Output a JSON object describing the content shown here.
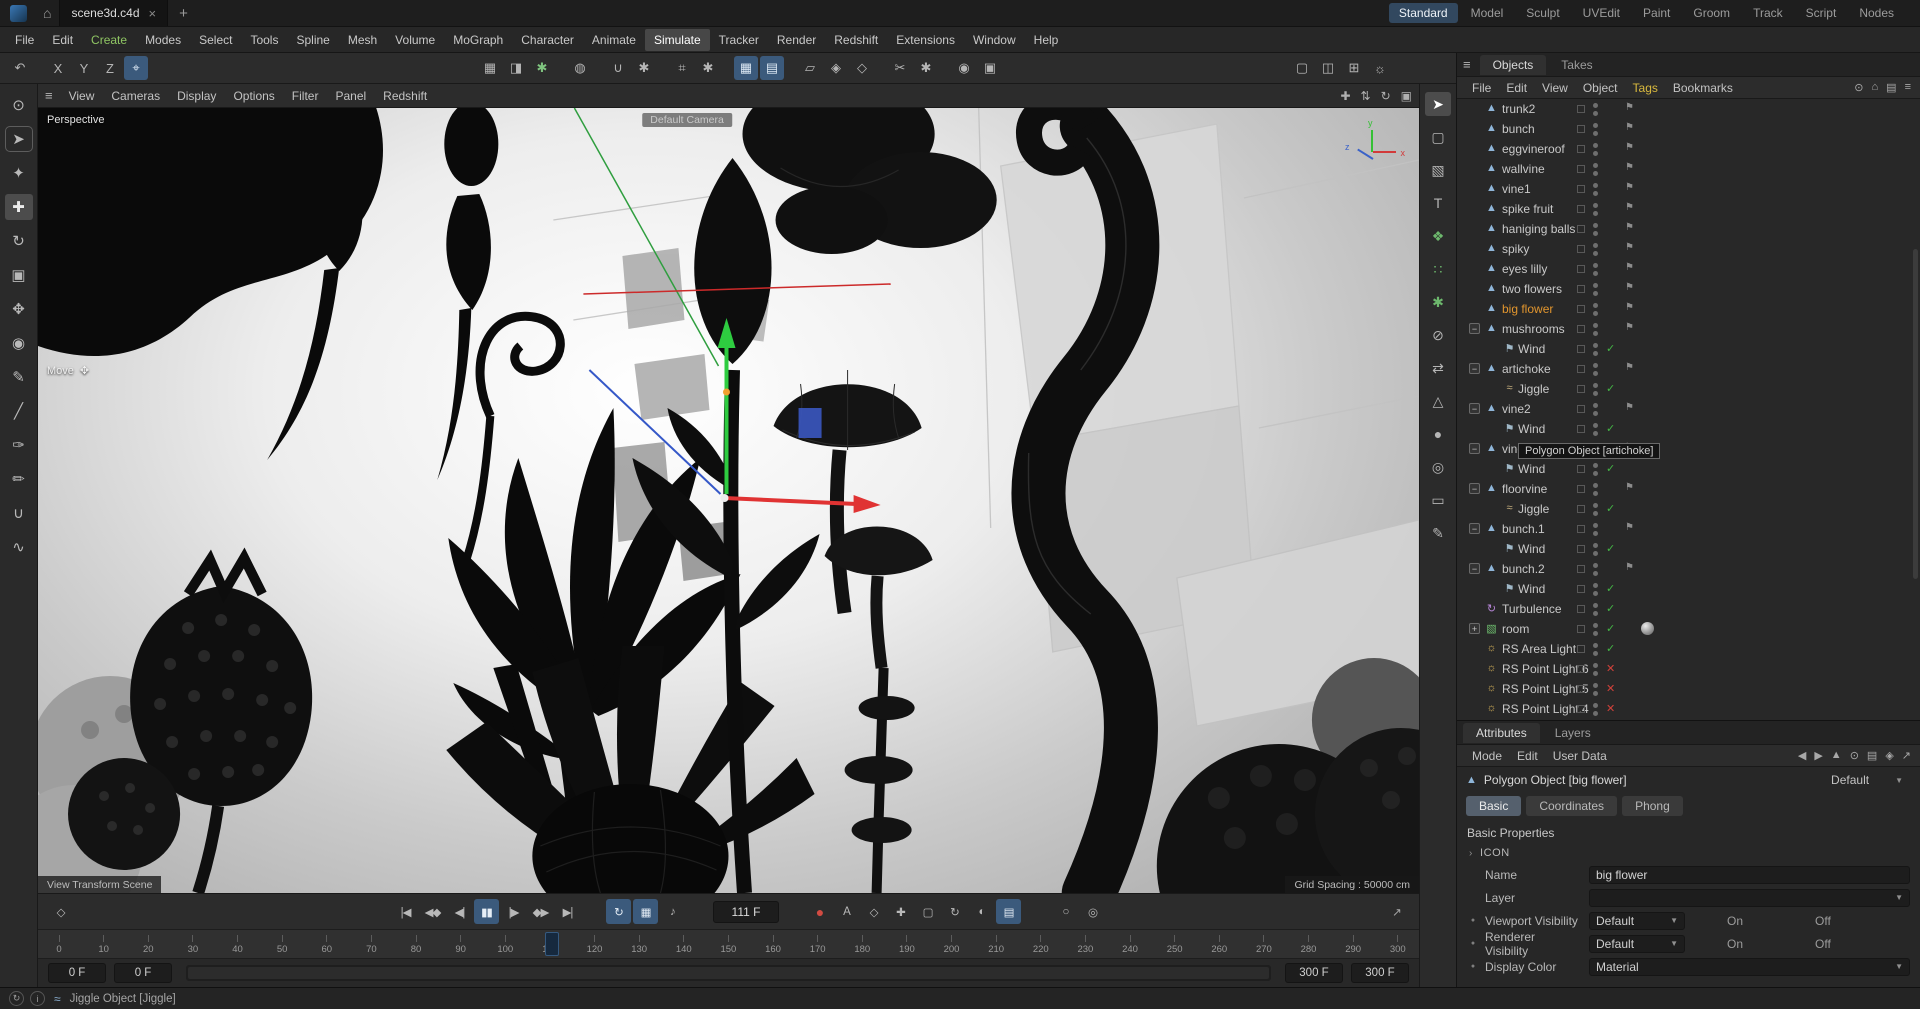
{
  "titlebar": {
    "tab_title": "scene3d.c4d",
    "close_glyph": "×",
    "add_glyph": "+",
    "home_glyph": "⌂",
    "layout_tabs": [
      {
        "name": "layout-standard",
        "label": "Standard",
        "active": true
      },
      {
        "name": "layout-model",
        "label": "Model"
      },
      {
        "name": "layout-sculpt",
        "label": "Sculpt"
      },
      {
        "name": "layout-uvedit",
        "label": "UVEdit"
      },
      {
        "name": "layout-paint",
        "label": "Paint"
      },
      {
        "name": "layout-groom",
        "label": "Groom"
      },
      {
        "name": "layout-track",
        "label": "Track"
      },
      {
        "name": "layout-script",
        "label": "Script"
      },
      {
        "name": "layout-nodes",
        "label": "Nodes"
      }
    ]
  },
  "menubar": {
    "items": [
      {
        "label": "File"
      },
      {
        "label": "Edit"
      },
      {
        "label": "Create",
        "accent": true
      },
      {
        "label": "Modes"
      },
      {
        "label": "Select"
      },
      {
        "label": "Tools"
      },
      {
        "label": "Spline"
      },
      {
        "label": "Mesh"
      },
      {
        "label": "Volume"
      },
      {
        "label": "MoGraph"
      },
      {
        "label": "Character"
      },
      {
        "label": "Animate"
      },
      {
        "label": "Simulate",
        "active": true
      },
      {
        "label": "Tracker"
      },
      {
        "label": "Render"
      },
      {
        "label": "Redshift"
      },
      {
        "label": "Extensions"
      },
      {
        "label": "Window"
      },
      {
        "label": "Help"
      }
    ]
  },
  "toolbar": {
    "g1": [
      {
        "name": "undo-icon",
        "glyph": "↶"
      }
    ],
    "g2": [
      {
        "name": "axis-x-toggle",
        "glyph": "X"
      },
      {
        "name": "axis-y-toggle",
        "glyph": "Y"
      },
      {
        "name": "axis-z-toggle",
        "glyph": "Z"
      },
      {
        "name": "coord-system-toggle",
        "glyph": "⌖",
        "active": true
      }
    ],
    "g3": [
      {
        "name": "render-view-button",
        "glyph": "▦"
      },
      {
        "name": "render-region-button",
        "glyph": "◨"
      },
      {
        "name": "render-settings-button",
        "glyph": "✱",
        "green": true
      }
    ],
    "g4": [
      {
        "name": "generators-button",
        "glyph": "◍"
      }
    ],
    "g5": [
      {
        "name": "snap-magnet-button",
        "glyph": "∪"
      },
      {
        "name": "snap-settings-button",
        "glyph": "✱"
      }
    ],
    "g6": [
      {
        "name": "anchor-button",
        "glyph": "⌗"
      },
      {
        "name": "anchor-settings-button",
        "glyph": "✱"
      }
    ],
    "g7": [
      {
        "name": "grid-snap-button",
        "glyph": "▦",
        "active": true
      },
      {
        "name": "quantize-button",
        "glyph": "▤",
        "active": true
      }
    ],
    "g8": [
      {
        "name": "workplane-button",
        "glyph": "▱"
      },
      {
        "name": "workplane-mode-button",
        "glyph": "◈"
      },
      {
        "name": "workplane-lock-button",
        "glyph": "◇"
      }
    ],
    "g9": [
      {
        "name": "cut-button",
        "glyph": "✂"
      },
      {
        "name": "cut-settings-button",
        "glyph": "✱"
      }
    ],
    "g10": [
      {
        "name": "axis-lock-button",
        "glyph": "◉"
      },
      {
        "name": "lock-button",
        "glyph": "▣"
      }
    ],
    "right": [
      {
        "name": "layout-single-view-button",
        "glyph": "▢"
      },
      {
        "name": "layout-split-view-button",
        "glyph": "◫"
      },
      {
        "name": "layout-quad-view-button",
        "glyph": "⊞"
      },
      {
        "name": "default-lights-button",
        "glyph": "☼"
      }
    ]
  },
  "left_toolbar": [
    {
      "name": "viewport-filter-icon",
      "glyph": "⊙"
    },
    {
      "name": "live-selection-icon",
      "glyph": "➤",
      "ring": true
    },
    {
      "name": "tweak-mode-icon",
      "glyph": "✦"
    },
    {
      "name": "move-tool-icon",
      "glyph": "✚",
      "active": true
    },
    {
      "name": "rotate-tool-icon",
      "glyph": "↻"
    },
    {
      "name": "scale-tool-icon",
      "glyph": "▣"
    },
    {
      "name": "axis-mode-icon",
      "glyph": "✥"
    },
    {
      "name": "soft-selection-icon",
      "glyph": "◉"
    },
    {
      "name": "pen-tool-icon",
      "glyph": "✎"
    },
    {
      "name": "knife-tool-icon",
      "glyph": "╱"
    },
    {
      "name": "brush-tool-icon",
      "glyph": "✑"
    },
    {
      "name": "pencil-tool-icon",
      "glyph": "✏"
    },
    {
      "name": "magnet-tool-icon",
      "glyph": "∪"
    },
    {
      "name": "spline-smooth-icon",
      "glyph": "∿"
    }
  ],
  "right_strip": [
    {
      "name": "select-arrow-icon",
      "glyph": "➤",
      "active": true
    },
    {
      "name": "marquee-icon",
      "glyph": "▢"
    },
    {
      "name": "cube-primitive-icon",
      "glyph": "▧"
    },
    {
      "name": "text-object-icon",
      "glyph": "T"
    },
    {
      "name": "cloner-icon",
      "glyph": "❖",
      "green": true
    },
    {
      "name": "matrix-icon",
      "glyph": "∷",
      "green": true
    },
    {
      "name": "dynamics-icon",
      "glyph": "✱",
      "green": true
    },
    {
      "name": "collision-icon",
      "glyph": "⊘"
    },
    {
      "name": "swap-icon",
      "glyph": "⇄"
    },
    {
      "name": "reduce-icon",
      "glyph": "△"
    },
    {
      "name": "sphere-primitive-icon",
      "glyph": "●"
    },
    {
      "name": "camera-object-icon",
      "glyph": "◎"
    },
    {
      "name": "plane-primitive-icon",
      "glyph": "▭"
    },
    {
      "name": "spline-pen-icon",
      "glyph": "✎"
    }
  ],
  "viewport": {
    "menu_icon": "≡",
    "menu": [
      {
        "label": "View"
      },
      {
        "label": "Cameras"
      },
      {
        "label": "Display"
      },
      {
        "label": "Options"
      },
      {
        "label": "Filter"
      },
      {
        "label": "Panel"
      },
      {
        "label": "Redshift"
      }
    ],
    "corner_icons": [
      {
        "name": "pan-view-icon",
        "glyph": "✚"
      },
      {
        "name": "dolly-view-icon",
        "glyph": "⇅"
      },
      {
        "name": "rotate-view-icon",
        "glyph": "↻"
      },
      {
        "name": "maximize-view-icon",
        "glyph": "▣"
      }
    ],
    "label": "Perspective",
    "camera_label": "Default Camera",
    "tool_label": "Move",
    "tool_glyph": "✥",
    "footer_left": "View Transform Scene",
    "footer_right": "Grid Spacing : 50000 cm",
    "axis_x": "x",
    "axis_y": "y",
    "axis_z": "z"
  },
  "object_manager": {
    "panel_tabs": [
      {
        "label": "Objects",
        "active": true
      },
      {
        "label": "Takes"
      }
    ],
    "menu": [
      {
        "label": "File"
      },
      {
        "label": "Edit"
      },
      {
        "label": "View"
      },
      {
        "label": "Object"
      },
      {
        "label": "Tags",
        "accent": true
      },
      {
        "label": "Bookmarks"
      }
    ],
    "icons": [
      {
        "name": "search-icon",
        "glyph": "⊙"
      },
      {
        "name": "home-icon",
        "glyph": "⌂"
      },
      {
        "name": "layer-filter-icon",
        "glyph": "▤"
      },
      {
        "name": "panel-menu-icon",
        "glyph": "≡"
      }
    ],
    "objects": [
      {
        "name": "trunk2",
        "icon": "▲",
        "icls": "ic-poly",
        "flag": true
      },
      {
        "name": "bunch",
        "icon": "▲",
        "icls": "ic-poly",
        "flag": true
      },
      {
        "name": "eggvineroof",
        "icon": "▲",
        "icls": "ic-poly",
        "flag": true
      },
      {
        "name": "wallvine",
        "icon": "▲",
        "icls": "ic-poly",
        "flag": true
      },
      {
        "name": "vine1",
        "icon": "▲",
        "icls": "ic-poly",
        "flag": true
      },
      {
        "name": "spike fruit",
        "icon": "▲",
        "icls": "ic-poly",
        "flag": true
      },
      {
        "name": "haniging balls",
        "icon": "▲",
        "icls": "ic-poly",
        "flag": true
      },
      {
        "name": "spiky",
        "icon": "▲",
        "icls": "ic-poly",
        "flag": true
      },
      {
        "name": "eyes lilly",
        "icon": "▲",
        "icls": "ic-poly",
        "flag": true
      },
      {
        "name": "two flowers",
        "icon": "▲",
        "icls": "ic-poly",
        "flag": true
      },
      {
        "name": "big flower",
        "icon": "▲",
        "icls": "ic-poly",
        "flag": true,
        "sel": true
      },
      {
        "name": "mushrooms",
        "icon": "▲",
        "icls": "ic-poly",
        "exp": "−",
        "flag": true
      },
      {
        "name": "Wind",
        "icon": "⚑",
        "icls": "ic-wind",
        "ind": true,
        "check": true
      },
      {
        "name": "artichoke",
        "icon": "▲",
        "icls": "ic-poly",
        "exp": "−",
        "flag": true
      },
      {
        "name": "Jiggle",
        "icon": "≈",
        "icls": "ic-jiggle",
        "ind": true,
        "check": true
      },
      {
        "name": "vine2",
        "icon": "▲",
        "icls": "ic-poly",
        "exp": "−",
        "flag": true
      },
      {
        "name": "Wind",
        "icon": "⚑",
        "icls": "ic-wind",
        "ind": true,
        "check": true
      },
      {
        "name": "vine2",
        "icon": "▲",
        "icls": "ic-poly",
        "exp": "−",
        "flag": true
      },
      {
        "name": "Wind",
        "icon": "⚑",
        "icls": "ic-wind",
        "ind": true,
        "check": true
      },
      {
        "name": "floorvine",
        "icon": "▲",
        "icls": "ic-poly",
        "exp": "−",
        "flag": true
      },
      {
        "name": "Jiggle",
        "icon": "≈",
        "icls": "ic-jiggle",
        "ind": true,
        "check": true
      },
      {
        "name": "bunch.1",
        "icon": "▲",
        "icls": "ic-poly",
        "exp": "−",
        "flag": true
      },
      {
        "name": "Wind",
        "icon": "⚑",
        "icls": "ic-wind",
        "ind": true,
        "check": true
      },
      {
        "name": "bunch.2",
        "icon": "▲",
        "icls": "ic-poly",
        "exp": "−",
        "flag": true
      },
      {
        "name": "Wind",
        "icon": "⚑",
        "icls": "ic-wind",
        "ind": true,
        "check": true
      },
      {
        "name": "Turbulence",
        "icon": "↻",
        "icls": "ic-turb",
        "check": true
      },
      {
        "name": "room",
        "icon": "▧",
        "icls": "ic-room",
        "exp": "+",
        "check": true,
        "ball": true
      },
      {
        "name": "RS Area Light",
        "icon": "☼",
        "icls": "ic-light",
        "check": true
      },
      {
        "name": "RS Point Light.6",
        "icon": "☼",
        "icls": "ic-light",
        "cross": true
      },
      {
        "name": "RS Point Light.5",
        "icon": "☼",
        "icls": "ic-light",
        "cross": true
      },
      {
        "name": "RS Point Light.4",
        "icon": "☼",
        "icls": "ic-light",
        "cross": true
      }
    ]
  },
  "tooltip": {
    "text": "Polygon Object [artichoke]"
  },
  "attributes": {
    "panel_tabs": [
      {
        "label": "Attributes",
        "active": true
      },
      {
        "label": "Layers"
      }
    ],
    "menu": [
      {
        "label": "Mode"
      },
      {
        "label": "Edit"
      },
      {
        "label": "User Data"
      }
    ],
    "icons": [
      {
        "name": "back-icon",
        "glyph": "◀"
      },
      {
        "name": "forward-icon",
        "glyph": "▶"
      },
      {
        "name": "up-icon",
        "glyph": "▲"
      },
      {
        "name": "search-icon",
        "glyph": "⊙"
      },
      {
        "name": "filter-icon",
        "glyph": "▤"
      },
      {
        "name": "lock-icon",
        "glyph": "◈"
      },
      {
        "name": "popout-icon",
        "glyph": "↗"
      }
    ],
    "object_title": "Polygon Object [big flower]",
    "preset_value": "Default",
    "tabs": [
      {
        "label": "Basic",
        "active": true
      },
      {
        "label": "Coordinates"
      },
      {
        "label": "Phong"
      }
    ],
    "section_title": "Basic Properties",
    "icon_group": "ICON",
    "fields": {
      "name_label": "Name",
      "name_value": "big flower",
      "layer_label": "Layer",
      "vv_label": "Viewport Visibility",
      "vv_value": "Default",
      "vv_on": "On",
      "vv_off": "Off",
      "rv_label": "Renderer Visibility",
      "rv_value": "Default",
      "rv_on": "On",
      "rv_off": "Off",
      "dc_label": "Display Color",
      "dc_value": "Material"
    }
  },
  "transport": {
    "marker": {
      "glyph": "◇"
    },
    "play_group": [
      {
        "name": "goto-start-button",
        "glyph": "|◀"
      },
      {
        "name": "prev-key-button",
        "glyph": "◀◆"
      },
      {
        "name": "prev-frame-button",
        "glyph": "◀|"
      },
      {
        "name": "play-pause-button",
        "glyph": "▮▮",
        "active": true
      },
      {
        "name": "next-frame-button",
        "glyph": "|▶"
      },
      {
        "name": "next-key-button",
        "glyph": "◆▶"
      },
      {
        "name": "goto-end-button",
        "glyph": "▶|"
      }
    ],
    "mode_group": [
      {
        "name": "loop-button",
        "glyph": "↻",
        "active": true
      },
      {
        "name": "key-mode-button",
        "glyph": "▦",
        "active": true
      },
      {
        "name": "sound-button",
        "glyph": "♪"
      }
    ],
    "frame_label": "111 F",
    "record_group": [
      {
        "name": "record-button",
        "glyph": "●",
        "red": true
      },
      {
        "name": "autokey-button",
        "glyph": "A"
      },
      {
        "name": "keyframe-selection-button",
        "glyph": "◇"
      },
      {
        "name": "record-position-button",
        "glyph": "✚"
      },
      {
        "name": "record-scale-button",
        "glyph": "▢"
      },
      {
        "name": "record-rotation-button",
        "glyph": "↻"
      },
      {
        "name": "record-parameter-button",
        "glyph": "◐"
      },
      {
        "name": "record-pla-button",
        "glyph": "▤",
        "active": true
      }
    ],
    "solo_group": [
      {
        "name": "solo-off-button",
        "glyph": "○"
      },
      {
        "name": "solo-single-button",
        "glyph": "◎"
      }
    ],
    "popout_glyph": "↗"
  },
  "timeline": {
    "current_frame": 111,
    "tick_max": 300,
    "ticks": [
      0,
      10,
      20,
      30,
      40,
      50,
      60,
      70,
      80,
      90,
      100,
      110,
      120,
      130,
      140,
      150,
      160,
      170,
      180,
      190,
      200,
      210,
      220,
      230,
      240,
      250,
      260,
      270,
      280,
      290,
      300
    ],
    "range_start_1": "0 F",
    "range_start_2": "0 F",
    "range_end_1": "300 F",
    "range_end_2": "300 F"
  },
  "statusbar": {
    "icons": [
      {
        "name": "refresh-icon",
        "glyph": "↻"
      },
      {
        "name": "info-icon",
        "glyph": "i"
      }
    ],
    "tag_glyph": "≈",
    "text": "Jiggle Object [Jiggle]"
  }
}
